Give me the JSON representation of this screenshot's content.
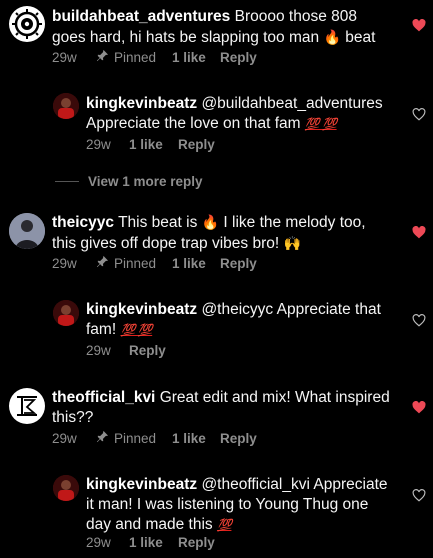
{
  "comments": [
    {
      "username": "buildahbeat_adventures",
      "text_line1": "Broooo those 808",
      "text_line2": "goes hard, hi hats be slapping too man",
      "text_emoji": "🔥",
      "text_end": "beat",
      "time": "29w",
      "pinned_label": "Pinned",
      "likes": "1 like",
      "reply": "Reply",
      "liked": true
    },
    {
      "username": "kingkevinbeatz",
      "mention": "@buildahbeat_adventures",
      "text_line2": "Appreciate the love on that fam",
      "hundreds": "💯 💯",
      "time": "29w",
      "likes": "1 like",
      "reply": "Reply",
      "liked": false
    },
    {
      "view_more": "View 1 more reply"
    },
    {
      "username": "theicyyc",
      "text_line1a": "This beat is",
      "text_emoji": "🔥",
      "text_line1b": "I like the melody too,",
      "text_line2": "this gives off dope trap vibes bro!",
      "text_emoji2": "🙌",
      "time": "29w",
      "pinned_label": "Pinned",
      "likes": "1 like",
      "reply": "Reply",
      "liked": true
    },
    {
      "username": "kingkevinbeatz",
      "mention": "@theicyyc",
      "text_line1": "Appreciate that",
      "text_line2": "fam!",
      "hundreds": "💯 💯",
      "time": "29w",
      "reply": "Reply",
      "liked": false
    },
    {
      "username": "theofficial_kvi",
      "text_line1": "Great edit and mix! What inspired",
      "text_line2": "this??",
      "time": "29w",
      "pinned_label": "Pinned",
      "likes": "1 like",
      "reply": "Reply",
      "liked": true
    },
    {
      "username": "kingkevinbeatz",
      "mention": "@theofficial_kvi",
      "text_line1": "Appreciate",
      "text_line2": "it man! I was listening to Young Thug one",
      "text_line3": "day and made this",
      "hundreds": "💯",
      "time": "29w",
      "likes": "1 like",
      "reply": "Reply",
      "liked": false
    }
  ],
  "colors": {
    "background": "#000000",
    "meta": "#8e8e8e",
    "heart_liked": "#ed4956"
  }
}
